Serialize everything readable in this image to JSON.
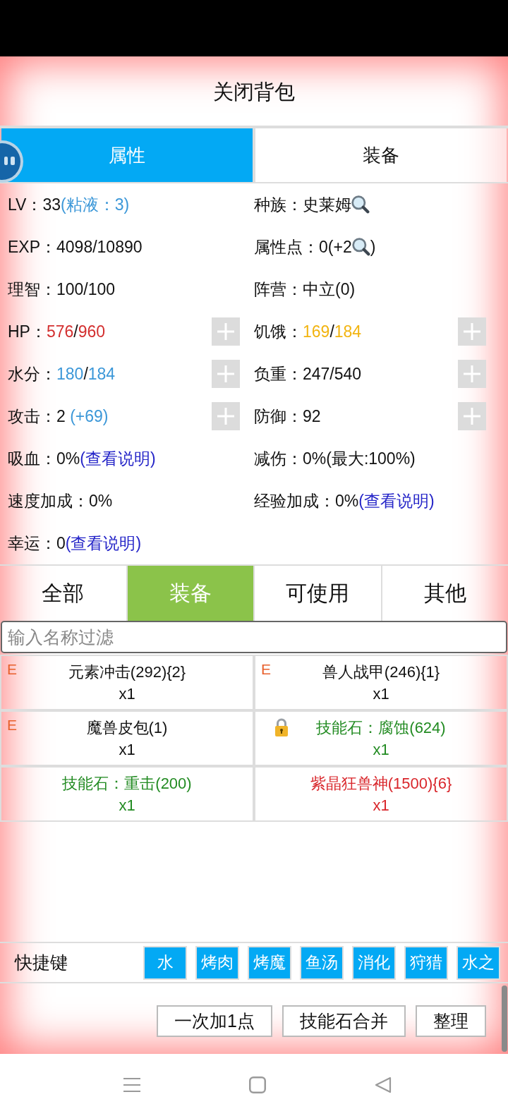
{
  "title": "关闭背包",
  "tabs": [
    {
      "label": "属性",
      "selected": true
    },
    {
      "label": "装备",
      "selected": false
    }
  ],
  "stats": [
    {
      "segments": [
        {
          "kind": "plain",
          "text": "LV：33"
        },
        {
          "kind": "note",
          "text": "(粘液：3)"
        }
      ],
      "addable": false
    },
    {
      "segments": [
        {
          "kind": "plain",
          "text": "种族：史莱姆"
        },
        {
          "kind": "lookup"
        }
      ],
      "addable": false
    },
    {
      "segments": [
        {
          "kind": "plain",
          "text": "EXP：4098/10890"
        }
      ],
      "addable": false
    },
    {
      "segments": [
        {
          "kind": "plain",
          "text": "属性点：0(+2"
        },
        {
          "kind": "lookup"
        },
        {
          "kind": "plain",
          "text": ")"
        }
      ],
      "addable": false
    },
    {
      "segments": [
        {
          "kind": "plain",
          "text": "理智：100/100"
        }
      ],
      "addable": false
    },
    {
      "segments": [
        {
          "kind": "plain",
          "text": "阵营：中立(0)"
        }
      ],
      "addable": false
    },
    {
      "segments": [
        {
          "kind": "plain",
          "text": "HP："
        },
        {
          "kind": "hp",
          "text": "576"
        },
        {
          "kind": "plain",
          "text": "/"
        },
        {
          "kind": "hp",
          "text": "960"
        }
      ],
      "addable": true
    },
    {
      "segments": [
        {
          "kind": "plain",
          "text": "饥饿："
        },
        {
          "kind": "hunger",
          "text": "169"
        },
        {
          "kind": "plain",
          "text": "/"
        },
        {
          "kind": "hunger",
          "text": "184"
        }
      ],
      "addable": true
    },
    {
      "segments": [
        {
          "kind": "plain",
          "text": "水分："
        },
        {
          "kind": "water",
          "text": "180"
        },
        {
          "kind": "plain",
          "text": "/"
        },
        {
          "kind": "water",
          "text": "184"
        }
      ],
      "addable": true
    },
    {
      "segments": [
        {
          "kind": "plain",
          "text": "负重：247/540"
        }
      ],
      "addable": true
    },
    {
      "segments": [
        {
          "kind": "plain",
          "text": "攻击：2 "
        },
        {
          "kind": "note",
          "text": "(+69)"
        }
      ],
      "addable": true
    },
    {
      "segments": [
        {
          "kind": "plain",
          "text": "防御：92"
        }
      ],
      "addable": true
    },
    {
      "segments": [
        {
          "kind": "plain",
          "text": "吸血：0%"
        },
        {
          "kind": "link",
          "text": "(查看说明)"
        }
      ],
      "addable": false
    },
    {
      "segments": [
        {
          "kind": "plain",
          "text": "减伤：0%(最大:100%)"
        }
      ],
      "addable": false
    },
    {
      "segments": [
        {
          "kind": "plain",
          "text": "速度加成：0%"
        }
      ],
      "addable": false
    },
    {
      "segments": [
        {
          "kind": "plain",
          "text": "经验加成：0%"
        },
        {
          "kind": "link",
          "text": "(查看说明)"
        }
      ],
      "addable": false
    },
    {
      "segments": [
        {
          "kind": "plain",
          "text": "幸运：0"
        },
        {
          "kind": "link",
          "text": "(查看说明)"
        }
      ],
      "addable": false
    }
  ],
  "filter_tabs": [
    {
      "label": "全部",
      "selected": false
    },
    {
      "label": "装备",
      "selected": true
    },
    {
      "label": "可使用",
      "selected": false
    },
    {
      "label": "其他",
      "selected": false
    }
  ],
  "filter": {
    "placeholder": "输入名称过滤"
  },
  "items": [
    {
      "marker": "E",
      "name": "元素冲击(292){2}",
      "count": "x1",
      "locked": false,
      "color": "#111111"
    },
    {
      "marker": "E",
      "name": "兽人战甲(246){1}",
      "count": "x1",
      "locked": false,
      "color": "#111111"
    },
    {
      "marker": "E",
      "name": "魔兽皮包(1)",
      "count": "x1",
      "locked": false,
      "color": "#111111"
    },
    {
      "name": "技能石：腐蚀(624)",
      "count": "x1",
      "locked": true,
      "color": "#228b22"
    },
    {
      "name": "技能石：重击(200)",
      "count": "x1",
      "locked": false,
      "color": "#228b22"
    },
    {
      "name": "紫晶狂兽神(1500){6}",
      "count": "x1",
      "locked": false,
      "color": "#d9262b"
    }
  ],
  "shortcuts": {
    "label": "快捷键",
    "keys": [
      "水",
      "烤肉",
      "烤魔",
      "鱼汤",
      "消化",
      "狩猎",
      "水之"
    ]
  },
  "actions": [
    "一次加1点",
    "技能石合并",
    "整理"
  ]
}
